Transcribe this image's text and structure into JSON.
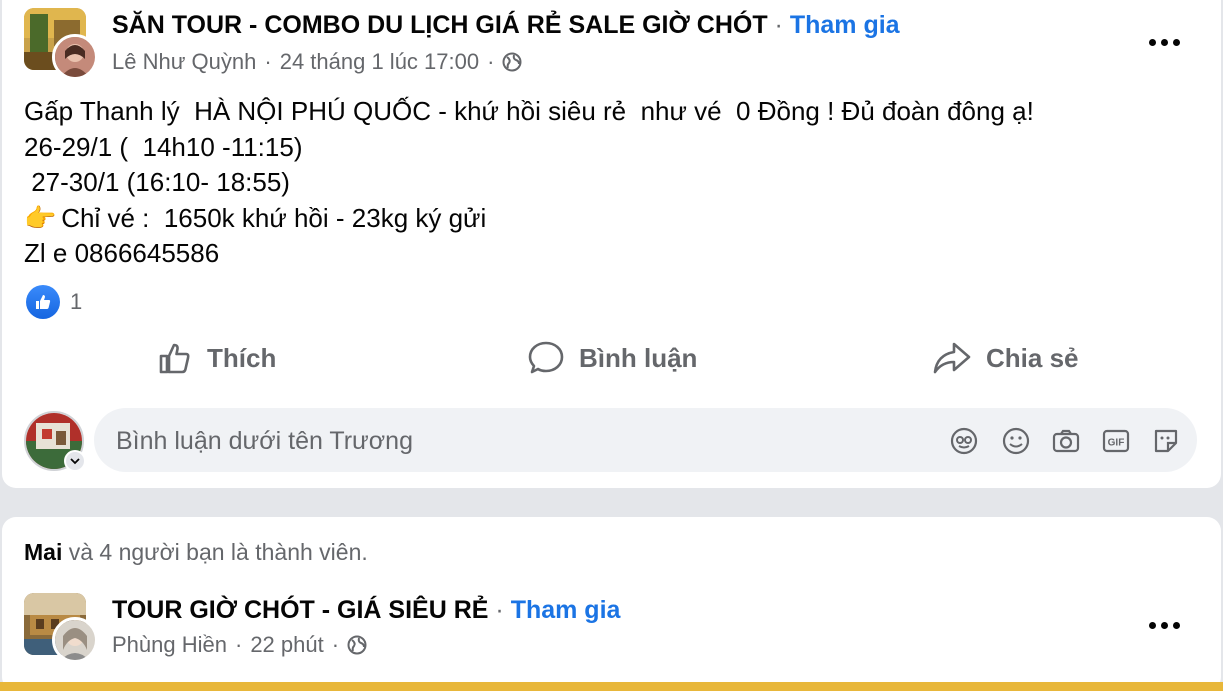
{
  "post1": {
    "group_name": "SĂN TOUR - COMBO DU LỊCH GIÁ RẺ SALE GIỜ CHÓT",
    "separator": "·",
    "join_label": "Tham gia",
    "author": "Lê Như Quỳnh",
    "timestamp": "24 tháng 1 lúc 17:00",
    "meta_sep": "·",
    "body_lines": [
      "Gấp Thanh lý  HÀ NỘI PHÚ QUỐC - khứ hồi siêu rẻ  như vé  0 Đồng ! Đủ đoàn đông ạ!",
      "26-29/1 (  14h10 -11:15)",
      " 27-30/1 (16:10- 18:55)",
      " Chỉ vé :  1650k khứ hồi - 23kg ký gửi",
      "Zl e 0866645586"
    ],
    "pointing_emoji": "👉",
    "reaction_count": "1",
    "actions": {
      "like": "Thích",
      "comment": "Bình luận",
      "share": "Chia sẻ"
    },
    "comment_placeholder": "Bình luận dưới tên Trương"
  },
  "post2": {
    "friends_name": "Mai",
    "friends_rest": " và 4 người bạn là thành viên.",
    "group_name": "TOUR GIỜ CHÓT - GIÁ SIÊU RẺ",
    "separator": "·",
    "join_label": "Tham gia",
    "author": "Phùng Hiền",
    "timestamp": "22 phút",
    "meta_sep": "·"
  },
  "colors": {
    "accent": "#1b74e4",
    "secondary_text": "#65676b",
    "banner": "#e8b73a"
  },
  "icons": [
    "globe-icon",
    "more-icon",
    "like-icon",
    "comment-icon",
    "share-icon",
    "avatar-icon",
    "emoji-icon",
    "camera-icon",
    "gif-icon",
    "sticker-icon"
  ]
}
